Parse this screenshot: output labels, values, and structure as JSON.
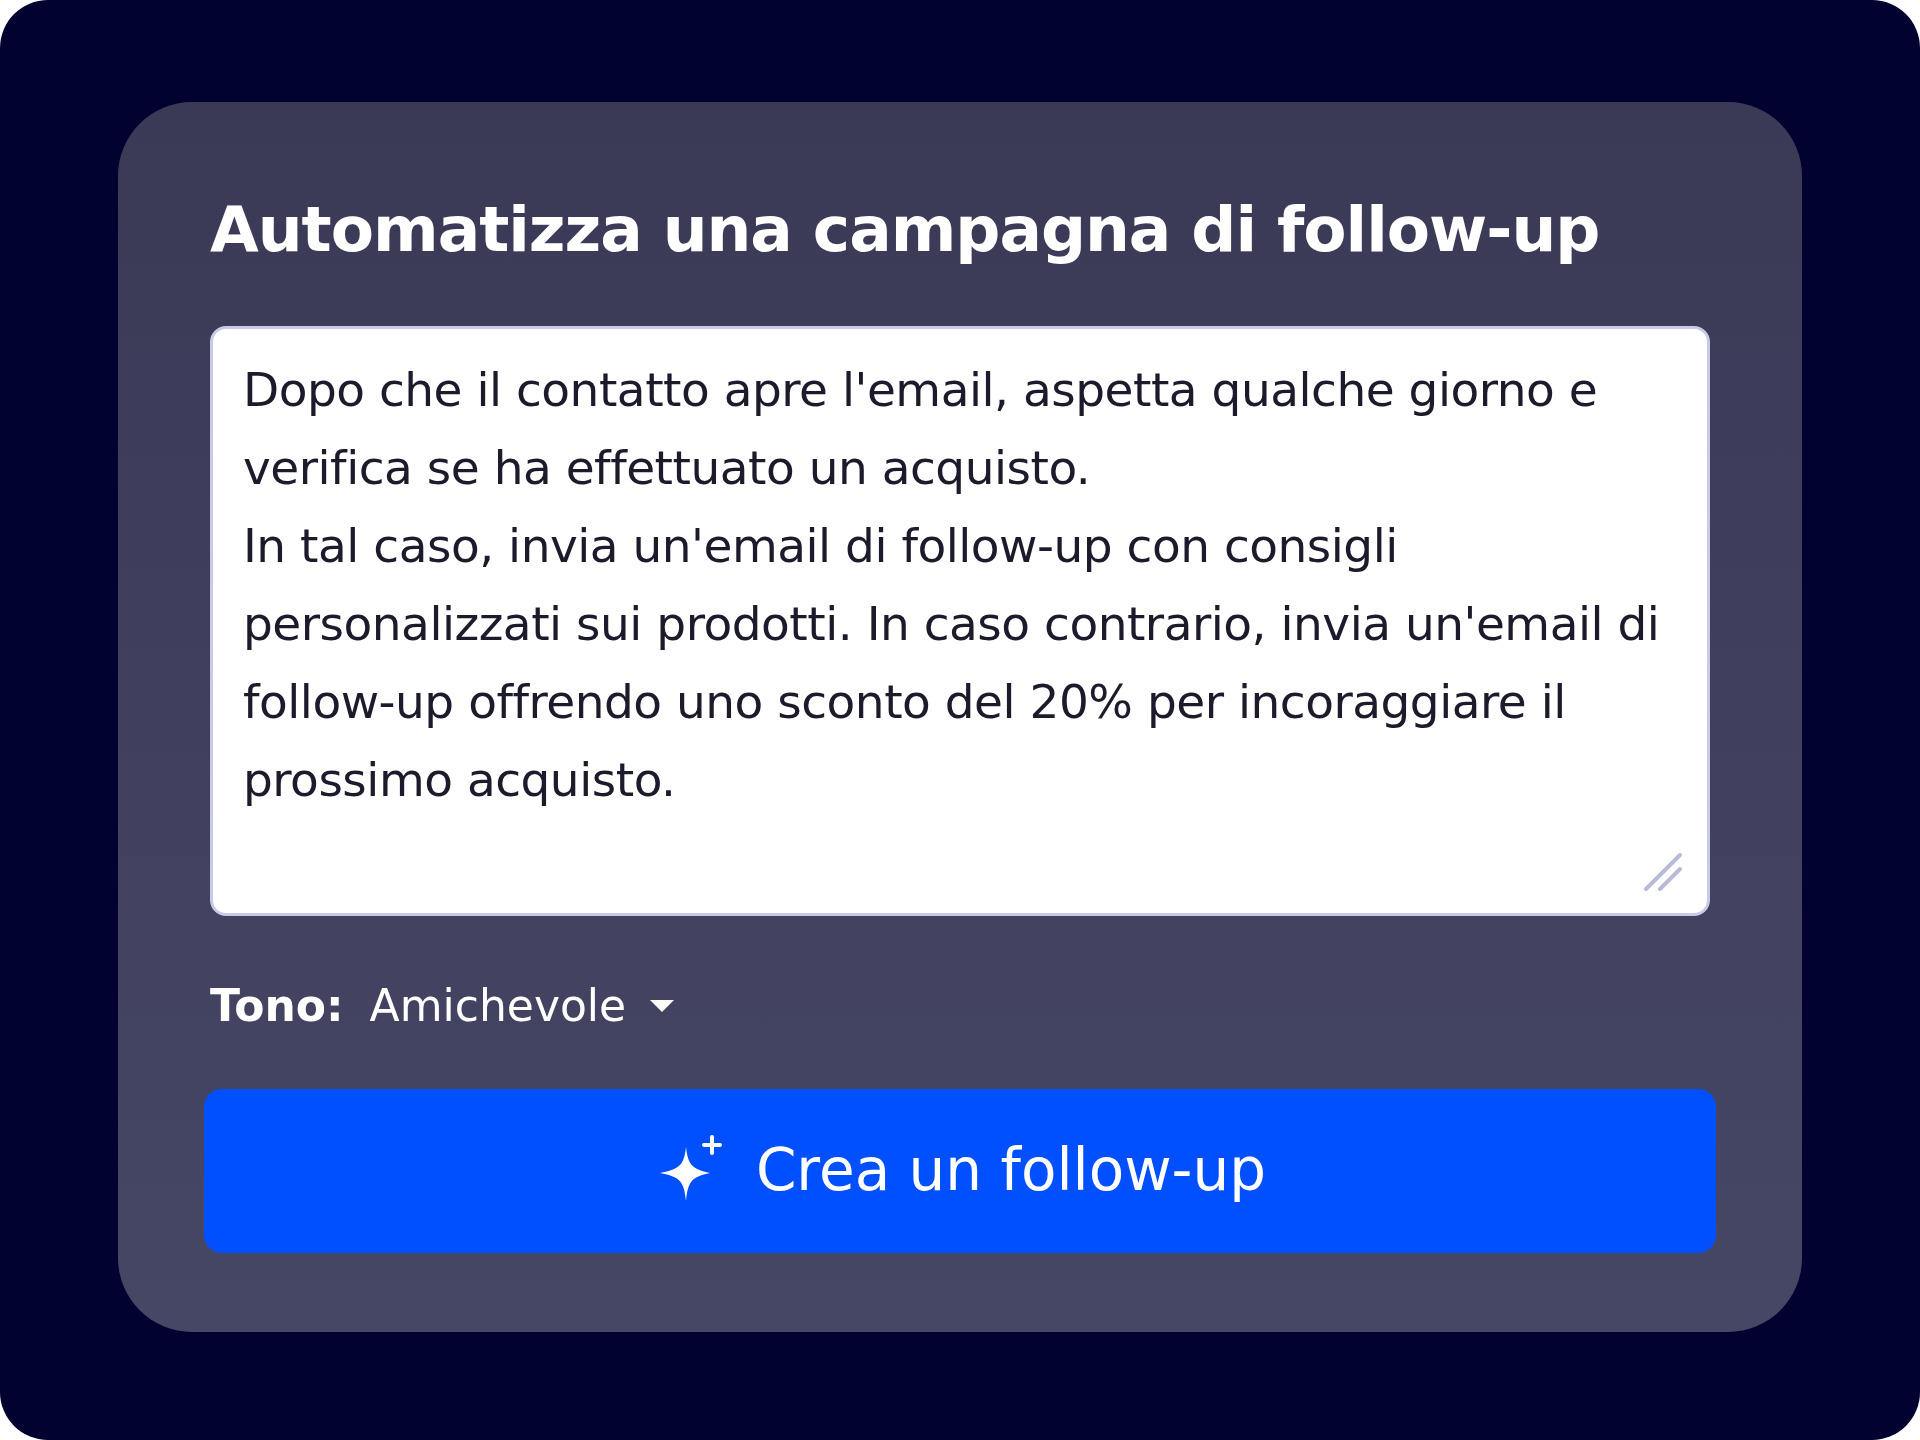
{
  "title": "Automatizza una campagna di follow-up",
  "prompt": {
    "value": "Dopo che il contatto apre l'email, aspetta qualche giorno e verifica se ha effettuato un acquisto.\nIn tal caso, invia un'email di follow-up con consigli personalizzati sui prodotti. In caso contrario, invia un'email di follow-up offrendo uno sconto del 20% per incoraggiare il prossimo acquisto."
  },
  "tone": {
    "label": "Tono:",
    "value": "Amichevole"
  },
  "button": {
    "label": "Crea un follow-up"
  }
}
